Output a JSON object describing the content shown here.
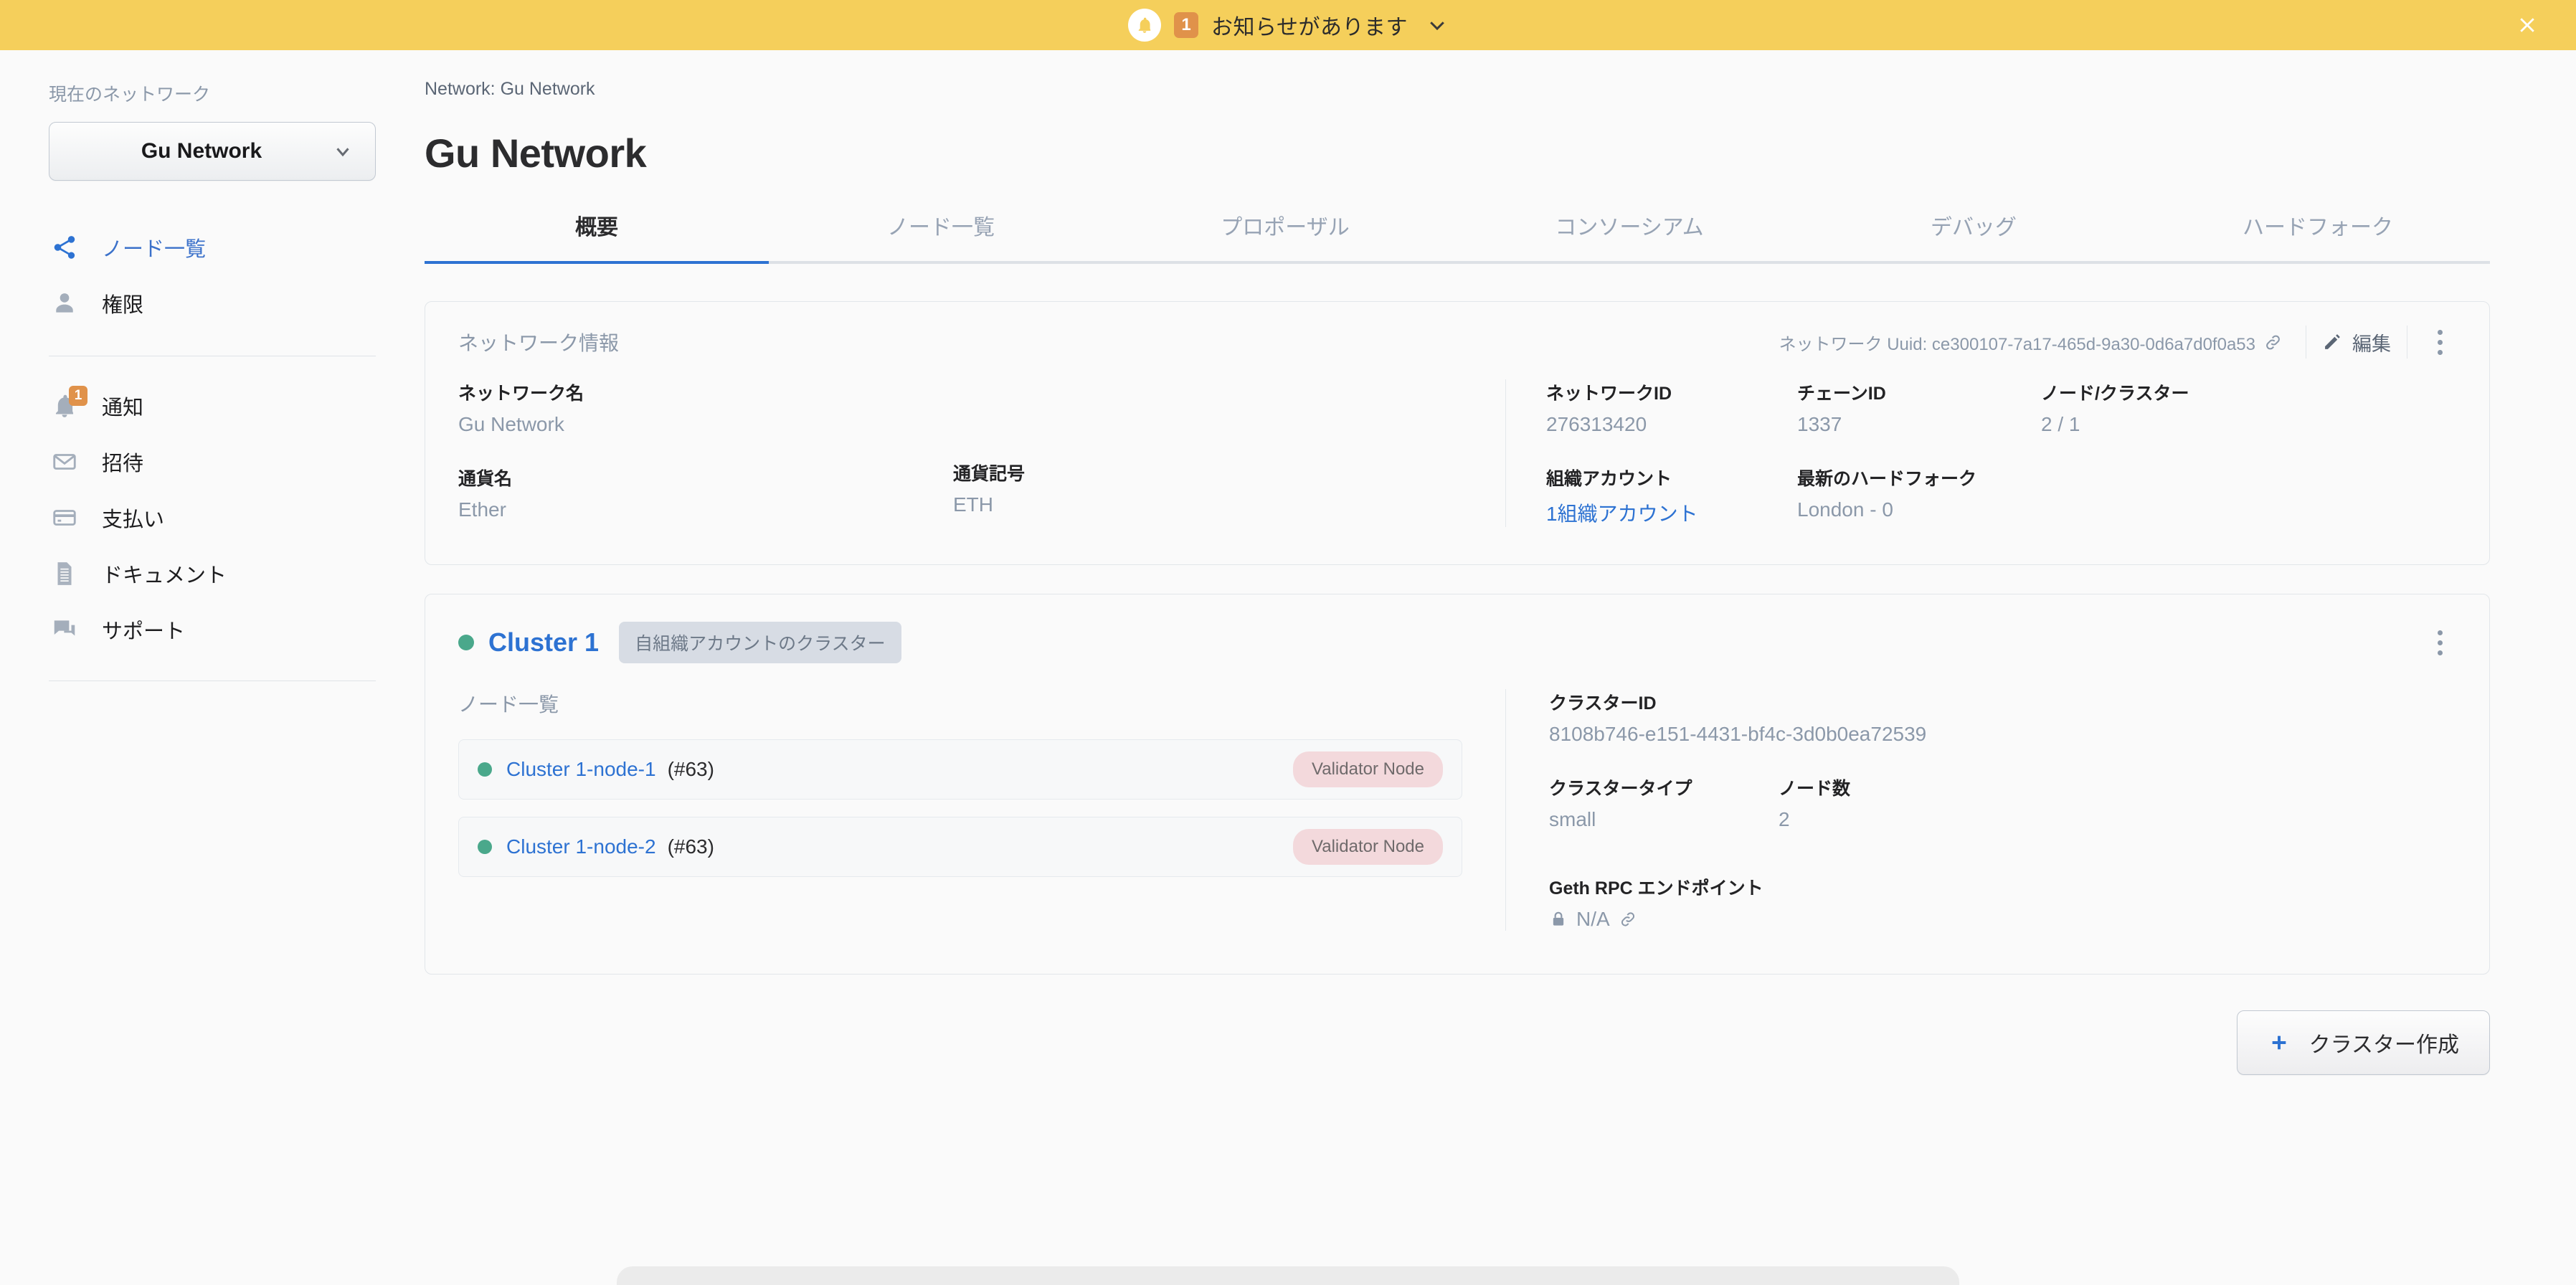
{
  "banner": {
    "bell_icon": "bell-icon",
    "badge_count": "1",
    "message": "お知らせがあります",
    "chevron_icon": "chevron-down-icon",
    "close_icon": "close-icon",
    "background_color": "#f5cf5b",
    "badge_color": "#e0924a"
  },
  "sidebar": {
    "section_label": "現在のネットワーク",
    "network_select": {
      "value": "Gu Network",
      "chevron_icon": "chevron-down-icon"
    },
    "primary_items": [
      {
        "label": "ノード一覧",
        "icon": "share-nodes-icon",
        "active": true
      },
      {
        "label": "権限",
        "icon": "person-icon",
        "active": false
      }
    ],
    "secondary_items": [
      {
        "label": "通知",
        "icon": "bell-icon",
        "badge": "1"
      },
      {
        "label": "招待",
        "icon": "envelope-icon",
        "badge": ""
      },
      {
        "label": "支払い",
        "icon": "credit-card-icon",
        "badge": ""
      },
      {
        "label": "ドキュメント",
        "icon": "document-icon",
        "badge": ""
      },
      {
        "label": "サポート",
        "icon": "chat-icon",
        "badge": ""
      }
    ]
  },
  "main": {
    "breadcrumb": "Network: Gu Network",
    "page_title": "Gu Network",
    "tabs": [
      {
        "label": "概要",
        "active": true
      },
      {
        "label": "ノード一覧",
        "active": false
      },
      {
        "label": "プロポーザル",
        "active": false
      },
      {
        "label": "コンソーシアム",
        "active": false
      },
      {
        "label": "デバッグ",
        "active": false
      },
      {
        "label": "ハードフォーク",
        "active": false
      }
    ],
    "network_info": {
      "card_title": "ネットワーク情報",
      "uuid_label": "ネットワーク Uuid: ce300107-7a17-465d-9a30-0d6a7d0f0a53",
      "copy_icon": "link-icon",
      "edit_label": "編集",
      "edit_icon": "pencil-icon",
      "more_icon": "kebab-menu-icon",
      "fields": {
        "network_name_label": "ネットワーク名",
        "network_name_value": "Gu Network",
        "currency_name_label": "通貨名",
        "currency_name_value": "Ether",
        "currency_symbol_label": "通貨記号",
        "currency_symbol_value": "ETH",
        "network_id_label": "ネットワークID",
        "network_id_value": "276313420",
        "chain_id_label": "チェーンID",
        "chain_id_value": "1337",
        "nodes_clusters_label": "ノード/クラスター",
        "nodes_clusters_value": "2 / 1",
        "org_account_label": "組織アカウント",
        "org_account_value": "1組織アカウント",
        "latest_hardfork_label": "最新のハードフォーク",
        "latest_hardfork_value": "London - 0"
      }
    },
    "cluster": {
      "status_icon": "status-dot-online",
      "name": "Cluster 1",
      "chip_label": "自組織アカウントのクラスター",
      "more_icon": "kebab-menu-icon",
      "node_list_title": "ノード一覧",
      "nodes": [
        {
          "name": "Cluster 1-node-1",
          "number": "(#63)",
          "tag": "Validator Node",
          "status": "online"
        },
        {
          "name": "Cluster 1-node-2",
          "number": "(#63)",
          "tag": "Validator Node",
          "status": "online"
        }
      ],
      "cluster_id_label": "クラスターID",
      "cluster_id_value": "8108b746-e151-4431-bf4c-3d0b0ea72539",
      "cluster_type_label": "クラスタータイプ",
      "cluster_type_value": "small",
      "node_count_label": "ノード数",
      "node_count_value": "2",
      "rpc_label": "Geth RPC エンドポイント",
      "rpc_value": "N/A",
      "rpc_lock_icon": "lock-icon",
      "rpc_link_icon": "link-icon"
    },
    "create_cluster_button": {
      "label": "クラスター作成",
      "icon": "plus-icon"
    }
  },
  "colors": {
    "accent_blue": "#2d72d2",
    "muted": "#8b98a9",
    "status_green": "#4aa88b",
    "tag_pink": "#f3d9dc",
    "banner_yellow": "#f5cf5b"
  }
}
